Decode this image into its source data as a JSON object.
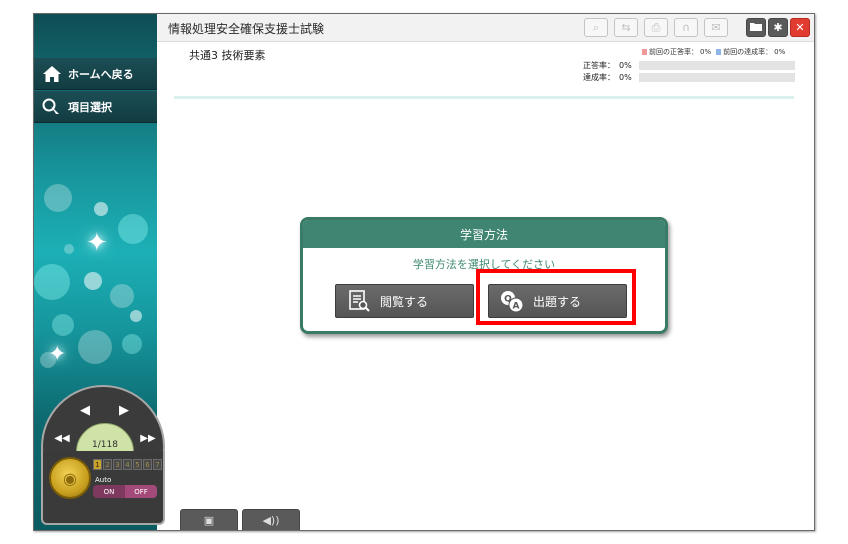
{
  "app": {
    "title": "情報処理安全確保支援士試験"
  },
  "sidebar": {
    "home_label": "ホームへ戻る",
    "select_label": "項目選択"
  },
  "player": {
    "page_counter": "1/118",
    "auto_label": "Auto",
    "on_label": "ON",
    "off_label": "OFF",
    "speed_levels": [
      "1",
      "2",
      "3",
      "4",
      "5",
      "6",
      "7"
    ],
    "speed_current": 1
  },
  "header": {
    "subject": "共通3 技術要素",
    "legend_prev_correct": "前回の正答率：",
    "legend_prev_correct_value": "0%",
    "legend_prev_achieve": "前回の達成率：",
    "legend_prev_achieve_value": "0%",
    "correct_rate_label": "正答率：",
    "correct_rate_value": "0%",
    "achieve_rate_label": "達成率：",
    "achieve_rate_value": "0%",
    "correct_rate_fraction": 0,
    "achieve_rate_fraction": 0
  },
  "toolbar": {
    "icons": [
      "search-icon",
      "swap-icon",
      "print-icon",
      "headphones-icon",
      "mail-icon",
      "folder-icon",
      "gear-icon",
      "close-icon"
    ]
  },
  "dialog": {
    "title": "学習方法",
    "prompt": "学習方法を選択してください",
    "browse_label": "閲覧する",
    "quiz_label": "出題する"
  },
  "colors": {
    "accent": "#3f8571",
    "highlight": "#ff0000",
    "legend_red": "#ef9a9a",
    "legend_blue": "#8fb6e8"
  }
}
